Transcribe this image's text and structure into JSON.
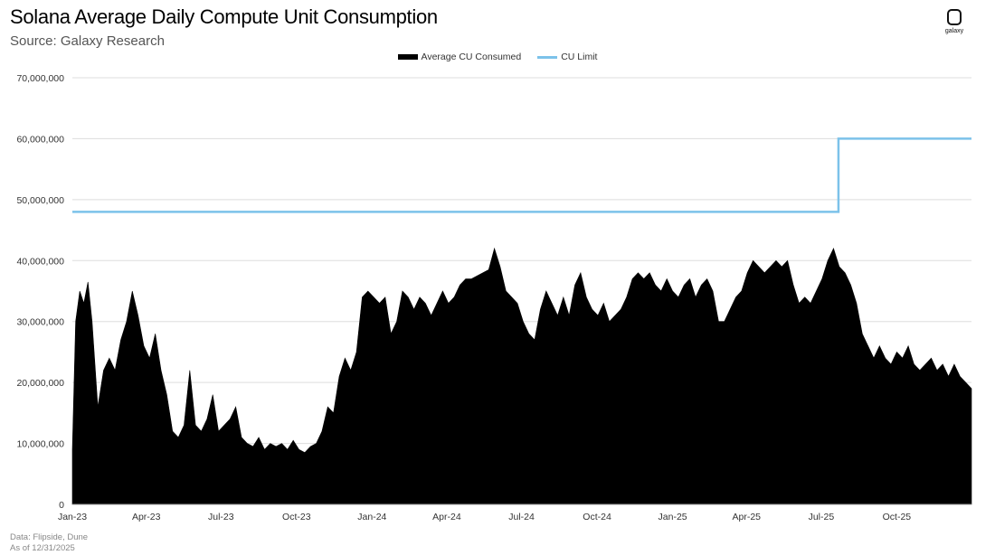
{
  "header": {
    "title": "Solana Average Daily Compute Unit Consumption",
    "subtitle": "Source: Galaxy Research"
  },
  "logo": {
    "text": "galaxy"
  },
  "footer": {
    "data_note": "Data: Flipside, Dune",
    "as_of": "As of 12/31/2025"
  },
  "colors": {
    "consumed": "#000000",
    "limit": "#7cc2ea",
    "grid": "#dddddd"
  },
  "chart_data": {
    "type": "area",
    "title": "Solana Average Daily Compute Unit Consumption",
    "subtitle": "Source: Galaxy Research",
    "xlabel": "",
    "ylabel": "",
    "ylim": [
      0,
      70000000
    ],
    "xlim": [
      "2023-01-01",
      "2025-12-31"
    ],
    "y_ticks": [
      0,
      10000000,
      20000000,
      30000000,
      40000000,
      50000000,
      60000000,
      70000000
    ],
    "y_tick_labels": [
      "0",
      "10,000,000",
      "20,000,000",
      "30,000,000",
      "40,000,000",
      "50,000,000",
      "60,000,000",
      "70,000,000"
    ],
    "x_tick_dates": [
      "2023-01-01",
      "2023-04-01",
      "2023-07-01",
      "2023-10-01",
      "2024-01-01",
      "2024-04-01",
      "2024-07-01",
      "2024-10-01",
      "2025-01-01",
      "2025-04-01",
      "2025-07-01",
      "2025-10-01"
    ],
    "x_tick_labels": [
      "Jan-23",
      "Apr-23",
      "Jul-23",
      "Oct-23",
      "Jan-24",
      "Apr-24",
      "Jul-24",
      "Oct-24",
      "Jan-25",
      "Apr-25",
      "Jul-25",
      "Oct-25"
    ],
    "grid": true,
    "legend_position": "top-center",
    "series": [
      {
        "name": "Average CU Consumed",
        "type": "area",
        "points": [
          [
            "2023-01-01",
            9000000
          ],
          [
            "2023-01-05",
            30000000
          ],
          [
            "2023-01-10",
            35000000
          ],
          [
            "2023-01-15",
            33000000
          ],
          [
            "2023-01-20",
            36500000
          ],
          [
            "2023-01-25",
            30000000
          ],
          [
            "2023-02-01",
            16000000
          ],
          [
            "2023-02-08",
            22000000
          ],
          [
            "2023-02-15",
            24000000
          ],
          [
            "2023-02-22",
            22000000
          ],
          [
            "2023-03-01",
            27000000
          ],
          [
            "2023-03-08",
            30000000
          ],
          [
            "2023-03-15",
            35000000
          ],
          [
            "2023-03-22",
            31000000
          ],
          [
            "2023-03-29",
            26000000
          ],
          [
            "2023-04-05",
            24000000
          ],
          [
            "2023-04-12",
            28000000
          ],
          [
            "2023-04-19",
            22000000
          ],
          [
            "2023-04-26",
            18000000
          ],
          [
            "2023-05-03",
            12000000
          ],
          [
            "2023-05-10",
            11000000
          ],
          [
            "2023-05-17",
            13000000
          ],
          [
            "2023-05-24",
            22000000
          ],
          [
            "2023-05-31",
            13000000
          ],
          [
            "2023-06-07",
            12000000
          ],
          [
            "2023-06-14",
            14000000
          ],
          [
            "2023-06-21",
            18000000
          ],
          [
            "2023-06-28",
            12000000
          ],
          [
            "2023-07-05",
            13000000
          ],
          [
            "2023-07-12",
            14000000
          ],
          [
            "2023-07-19",
            16000000
          ],
          [
            "2023-07-26",
            11000000
          ],
          [
            "2023-08-02",
            10000000
          ],
          [
            "2023-08-09",
            9500000
          ],
          [
            "2023-08-16",
            11000000
          ],
          [
            "2023-08-23",
            9000000
          ],
          [
            "2023-08-30",
            10000000
          ],
          [
            "2023-09-06",
            9500000
          ],
          [
            "2023-09-13",
            10000000
          ],
          [
            "2023-09-20",
            9000000
          ],
          [
            "2023-09-27",
            10500000
          ],
          [
            "2023-10-04",
            9000000
          ],
          [
            "2023-10-11",
            8500000
          ],
          [
            "2023-10-18",
            9500000
          ],
          [
            "2023-10-25",
            10000000
          ],
          [
            "2023-11-01",
            12000000
          ],
          [
            "2023-11-08",
            16000000
          ],
          [
            "2023-11-15",
            15000000
          ],
          [
            "2023-11-22",
            21000000
          ],
          [
            "2023-11-29",
            24000000
          ],
          [
            "2023-12-06",
            22000000
          ],
          [
            "2023-12-13",
            25000000
          ],
          [
            "2023-12-20",
            34000000
          ],
          [
            "2023-12-27",
            35000000
          ],
          [
            "2024-01-03",
            34000000
          ],
          [
            "2024-01-10",
            33000000
          ],
          [
            "2024-01-17",
            34000000
          ],
          [
            "2024-01-24",
            28000000
          ],
          [
            "2024-01-31",
            30000000
          ],
          [
            "2024-02-07",
            35000000
          ],
          [
            "2024-02-14",
            34000000
          ],
          [
            "2024-02-21",
            32000000
          ],
          [
            "2024-02-28",
            34000000
          ],
          [
            "2024-03-06",
            33000000
          ],
          [
            "2024-03-13",
            31000000
          ],
          [
            "2024-03-20",
            33000000
          ],
          [
            "2024-03-27",
            35000000
          ],
          [
            "2024-04-03",
            33000000
          ],
          [
            "2024-04-10",
            34000000
          ],
          [
            "2024-04-17",
            36000000
          ],
          [
            "2024-04-24",
            37000000
          ],
          [
            "2024-05-01",
            37000000
          ],
          [
            "2024-05-08",
            37500000
          ],
          [
            "2024-05-15",
            38000000
          ],
          [
            "2024-05-22",
            38500000
          ],
          [
            "2024-05-29",
            42000000
          ],
          [
            "2024-06-05",
            39000000
          ],
          [
            "2024-06-12",
            35000000
          ],
          [
            "2024-06-19",
            34000000
          ],
          [
            "2024-06-26",
            33000000
          ],
          [
            "2024-07-03",
            30000000
          ],
          [
            "2024-07-10",
            28000000
          ],
          [
            "2024-07-17",
            27000000
          ],
          [
            "2024-07-24",
            32000000
          ],
          [
            "2024-07-31",
            35000000
          ],
          [
            "2024-08-07",
            33000000
          ],
          [
            "2024-08-14",
            31000000
          ],
          [
            "2024-08-21",
            34000000
          ],
          [
            "2024-08-28",
            31000000
          ],
          [
            "2024-09-04",
            36000000
          ],
          [
            "2024-09-11",
            38000000
          ],
          [
            "2024-09-18",
            34000000
          ],
          [
            "2024-09-25",
            32000000
          ],
          [
            "2024-10-02",
            31000000
          ],
          [
            "2024-10-09",
            33000000
          ],
          [
            "2024-10-16",
            30000000
          ],
          [
            "2024-10-23",
            31000000
          ],
          [
            "2024-10-30",
            32000000
          ],
          [
            "2024-11-06",
            34000000
          ],
          [
            "2024-11-13",
            37000000
          ],
          [
            "2024-11-20",
            38000000
          ],
          [
            "2024-11-27",
            37000000
          ],
          [
            "2024-12-04",
            38000000
          ],
          [
            "2024-12-11",
            36000000
          ],
          [
            "2024-12-18",
            35000000
          ],
          [
            "2024-12-25",
            37000000
          ],
          [
            "2025-01-01",
            35000000
          ],
          [
            "2025-01-08",
            34000000
          ],
          [
            "2025-01-15",
            36000000
          ],
          [
            "2025-01-22",
            37000000
          ],
          [
            "2025-01-29",
            34000000
          ],
          [
            "2025-02-05",
            36000000
          ],
          [
            "2025-02-12",
            37000000
          ],
          [
            "2025-02-19",
            35000000
          ],
          [
            "2025-02-26",
            30000000
          ],
          [
            "2025-03-05",
            30000000
          ],
          [
            "2025-03-12",
            32000000
          ],
          [
            "2025-03-19",
            34000000
          ],
          [
            "2025-03-26",
            35000000
          ],
          [
            "2025-04-02",
            38000000
          ],
          [
            "2025-04-09",
            40000000
          ],
          [
            "2025-04-16",
            39000000
          ],
          [
            "2025-04-23",
            38000000
          ],
          [
            "2025-04-30",
            39000000
          ],
          [
            "2025-05-07",
            40000000
          ],
          [
            "2025-05-14",
            39000000
          ],
          [
            "2025-05-21",
            40000000
          ],
          [
            "2025-05-28",
            36000000
          ],
          [
            "2025-06-04",
            33000000
          ],
          [
            "2025-06-11",
            34000000
          ],
          [
            "2025-06-18",
            33000000
          ],
          [
            "2025-06-25",
            35000000
          ],
          [
            "2025-07-02",
            37000000
          ],
          [
            "2025-07-09",
            40000000
          ],
          [
            "2025-07-16",
            42000000
          ],
          [
            "2025-07-23",
            39000000
          ],
          [
            "2025-07-30",
            38000000
          ],
          [
            "2025-08-06",
            36000000
          ],
          [
            "2025-08-13",
            33000000
          ],
          [
            "2025-08-20",
            28000000
          ],
          [
            "2025-08-27",
            26000000
          ],
          [
            "2025-09-03",
            24000000
          ],
          [
            "2025-09-10",
            26000000
          ],
          [
            "2025-09-17",
            24000000
          ],
          [
            "2025-09-24",
            23000000
          ],
          [
            "2025-10-01",
            25000000
          ],
          [
            "2025-10-08",
            24000000
          ],
          [
            "2025-10-15",
            26000000
          ],
          [
            "2025-10-22",
            23000000
          ],
          [
            "2025-10-29",
            22000000
          ],
          [
            "2025-11-05",
            23000000
          ],
          [
            "2025-11-12",
            24000000
          ],
          [
            "2025-11-19",
            22000000
          ],
          [
            "2025-11-26",
            23000000
          ],
          [
            "2025-12-03",
            21000000
          ],
          [
            "2025-12-10",
            23000000
          ],
          [
            "2025-12-17",
            21000000
          ],
          [
            "2025-12-24",
            20000000
          ],
          [
            "2025-12-31",
            19000000
          ]
        ]
      },
      {
        "name": "CU Limit",
        "type": "step",
        "points": [
          [
            "2023-01-01",
            48000000
          ],
          [
            "2025-07-22",
            48000000
          ],
          [
            "2025-07-22",
            60000000
          ],
          [
            "2025-12-31",
            60000000
          ]
        ]
      }
    ]
  }
}
